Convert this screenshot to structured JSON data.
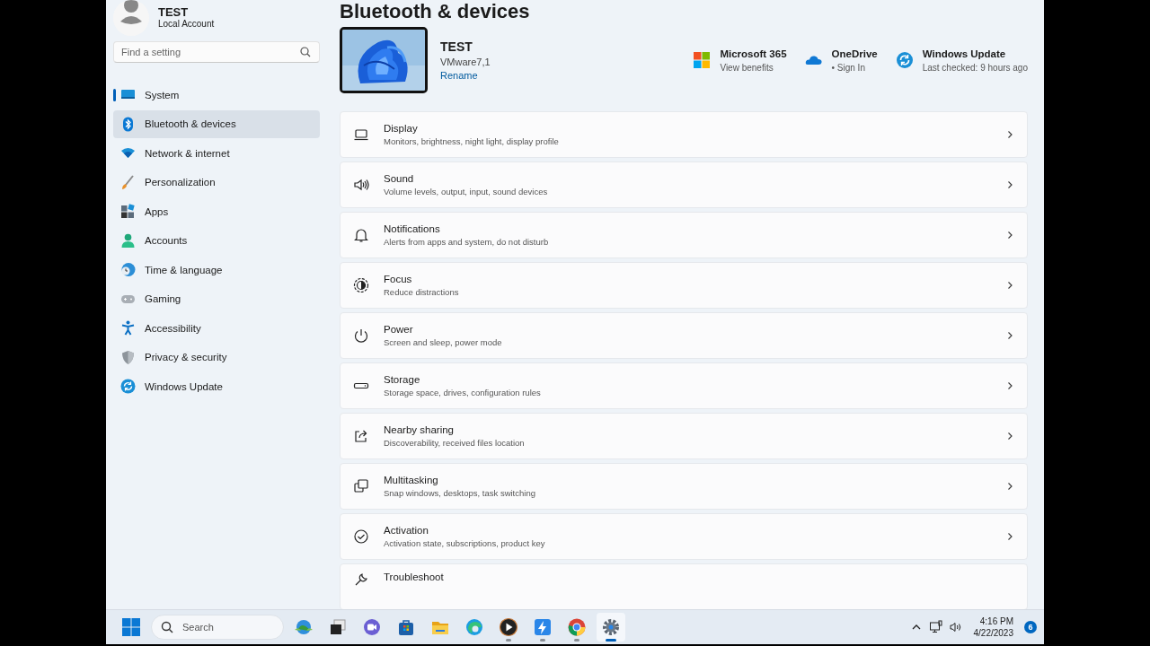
{
  "sidebar": {
    "user": {
      "name": "TEST",
      "account": "Local Account"
    },
    "search": {
      "placeholder": "Find a setting"
    },
    "items": [
      {
        "label": "System",
        "selected": true,
        "hovered": false
      },
      {
        "label": "Bluetooth & devices",
        "selected": false,
        "hovered": true
      },
      {
        "label": "Network & internet",
        "selected": false,
        "hovered": false
      },
      {
        "label": "Personalization",
        "selected": false,
        "hovered": false
      },
      {
        "label": "Apps",
        "selected": false,
        "hovered": false
      },
      {
        "label": "Accounts",
        "selected": false,
        "hovered": false
      },
      {
        "label": "Time & language",
        "selected": false,
        "hovered": false
      },
      {
        "label": "Gaming",
        "selected": false,
        "hovered": false
      },
      {
        "label": "Accessibility",
        "selected": false,
        "hovered": false
      },
      {
        "label": "Privacy & security",
        "selected": false,
        "hovered": false
      },
      {
        "label": "Windows Update",
        "selected": false,
        "hovered": false
      }
    ]
  },
  "main": {
    "heading": "Bluetooth & devices",
    "device": {
      "name": "TEST",
      "model": "VMware7,1",
      "rename": "Rename"
    },
    "quick_links": [
      {
        "title": "Microsoft 365",
        "subtitle": "View benefits"
      },
      {
        "title": "OneDrive",
        "subtitle": "• Sign In"
      },
      {
        "title": "Windows Update",
        "subtitle": "Last checked: 9 hours ago"
      }
    ],
    "cards": [
      {
        "title": "Display",
        "subtitle": "Monitors, brightness, night light, display profile"
      },
      {
        "title": "Sound",
        "subtitle": "Volume levels, output, input, sound devices"
      },
      {
        "title": "Notifications",
        "subtitle": "Alerts from apps and system, do not disturb"
      },
      {
        "title": "Focus",
        "subtitle": "Reduce distractions"
      },
      {
        "title": "Power",
        "subtitle": "Screen and sleep, power mode"
      },
      {
        "title": "Storage",
        "subtitle": "Storage space, drives, configuration rules"
      },
      {
        "title": "Nearby sharing",
        "subtitle": "Discoverability, received files location"
      },
      {
        "title": "Multitasking",
        "subtitle": "Snap windows, desktops, task switching"
      },
      {
        "title": "Activation",
        "subtitle": "Activation state, subscriptions, product key"
      },
      {
        "title": "Troubleshoot"
      }
    ]
  },
  "taskbar": {
    "search": {
      "placeholder": "Search"
    },
    "apps": [
      {
        "running": false,
        "active": false
      },
      {
        "running": false,
        "active": false
      },
      {
        "running": false,
        "active": false
      },
      {
        "running": false,
        "active": false
      },
      {
        "running": false,
        "active": false
      },
      {
        "running": false,
        "active": false
      },
      {
        "running": true,
        "active": false
      },
      {
        "running": true,
        "active": false
      },
      {
        "running": true,
        "active": false
      },
      {
        "running": true,
        "active": true
      }
    ],
    "clock": {
      "time": "4:16 PM",
      "date": "4/22/2023"
    },
    "notifications": "6"
  }
}
